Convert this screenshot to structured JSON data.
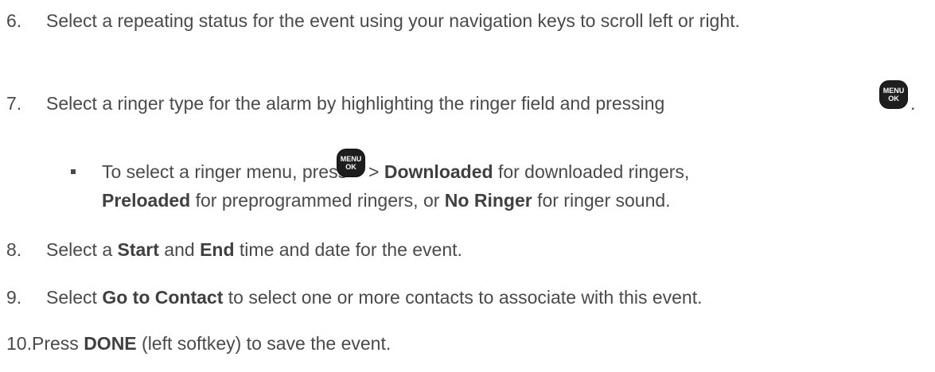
{
  "steps": [
    {
      "num": "6.",
      "text": "Select a repeating status for the event using your navigation keys to scroll left or right."
    },
    {
      "num": "7.",
      "text": "Select a ringer type for the alarm by highlighting the ringer field and pressing",
      "after": "."
    },
    {
      "num": "8.",
      "t1": "Select a ",
      "b1": "Start",
      "t2": " and ",
      "b2": "End",
      "t3": " time and date for the event."
    },
    {
      "num": "9.",
      "t1": "Select ",
      "b1": "Go to Contact",
      "t2": " to select one or more contacts to associate with this event."
    },
    {
      "num": "10.",
      "t1": "Press ",
      "b1": "DONE",
      "t2": " (left softkey) to save the event."
    }
  ],
  "sub_bullet": {
    "t1": "To select a ringer menu, press",
    "t2": " > ",
    "b1": "Downloaded",
    "t3": " for downloaded ringers,",
    "b2": "Preloaded",
    "t4": " for preprogrammed ringers, or ",
    "b3": "No Ringer",
    "t5": " for ringer sound."
  },
  "menu_key": {
    "line1": "MENU",
    "line2": "OK",
    "icon": "menu-ok-key-icon"
  }
}
